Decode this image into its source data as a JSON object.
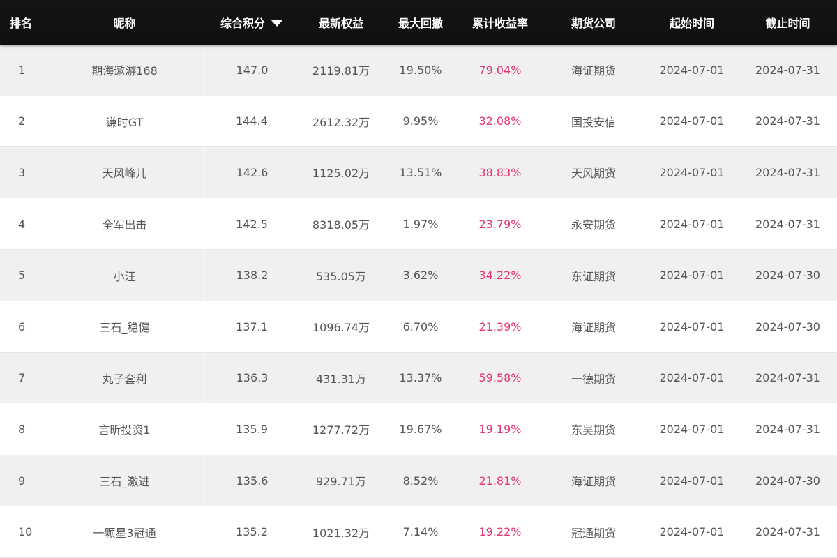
{
  "header": {
    "rank": "排名",
    "nickname": "昵称",
    "score": "综合积分",
    "equity": "最新权益",
    "drawdown": "最大回撤",
    "return": "累计收益率",
    "company": "期货公司",
    "start": "起始时间",
    "end": "截止时间",
    "sort_icon": "caret-down-icon"
  },
  "colors": {
    "header_bg": "#121212",
    "return_text": "#e8336e",
    "stripe": "#f0f0f0"
  },
  "rows": [
    {
      "rank": "1",
      "nickname": "期海遨游168",
      "score": "147.0",
      "equity": "2119.81万",
      "drawdown": "19.50%",
      "return": "79.04%",
      "company": "海证期货",
      "start": "2024-07-01",
      "end": "2024-07-31"
    },
    {
      "rank": "2",
      "nickname": "谦时GT",
      "score": "144.4",
      "equity": "2612.32万",
      "drawdown": "9.95%",
      "return": "32.08%",
      "company": "国投安信",
      "start": "2024-07-01",
      "end": "2024-07-31"
    },
    {
      "rank": "3",
      "nickname": "天风峰儿",
      "score": "142.6",
      "equity": "1125.02万",
      "drawdown": "13.51%",
      "return": "38.83%",
      "company": "天风期货",
      "start": "2024-07-01",
      "end": "2024-07-31"
    },
    {
      "rank": "4",
      "nickname": "全军出击",
      "score": "142.5",
      "equity": "8318.05万",
      "drawdown": "1.97%",
      "return": "23.79%",
      "company": "永安期货",
      "start": "2024-07-01",
      "end": "2024-07-31"
    },
    {
      "rank": "5",
      "nickname": "小汪",
      "score": "138.2",
      "equity": "535.05万",
      "drawdown": "3.62%",
      "return": "34.22%",
      "company": "东证期货",
      "start": "2024-07-01",
      "end": "2024-07-30"
    },
    {
      "rank": "6",
      "nickname": "三石_稳健",
      "score": "137.1",
      "equity": "1096.74万",
      "drawdown": "6.70%",
      "return": "21.39%",
      "company": "海证期货",
      "start": "2024-07-01",
      "end": "2024-07-30"
    },
    {
      "rank": "7",
      "nickname": "丸子套利",
      "score": "136.3",
      "equity": "431.31万",
      "drawdown": "13.37%",
      "return": "59.58%",
      "company": "一德期货",
      "start": "2024-07-01",
      "end": "2024-07-31"
    },
    {
      "rank": "8",
      "nickname": "言昕投资1",
      "score": "135.9",
      "equity": "1277.72万",
      "drawdown": "19.67%",
      "return": "19.19%",
      "company": "东吴期货",
      "start": "2024-07-01",
      "end": "2024-07-31"
    },
    {
      "rank": "9",
      "nickname": "三石_激进",
      "score": "135.6",
      "equity": "929.71万",
      "drawdown": "8.52%",
      "return": "21.81%",
      "company": "海证期货",
      "start": "2024-07-01",
      "end": "2024-07-30"
    },
    {
      "rank": "10",
      "nickname": "一颗星3冠通",
      "score": "135.2",
      "equity": "1021.32万",
      "drawdown": "7.14%",
      "return": "19.22%",
      "company": "冠通期货",
      "start": "2024-07-01",
      "end": "2024-07-31"
    }
  ]
}
